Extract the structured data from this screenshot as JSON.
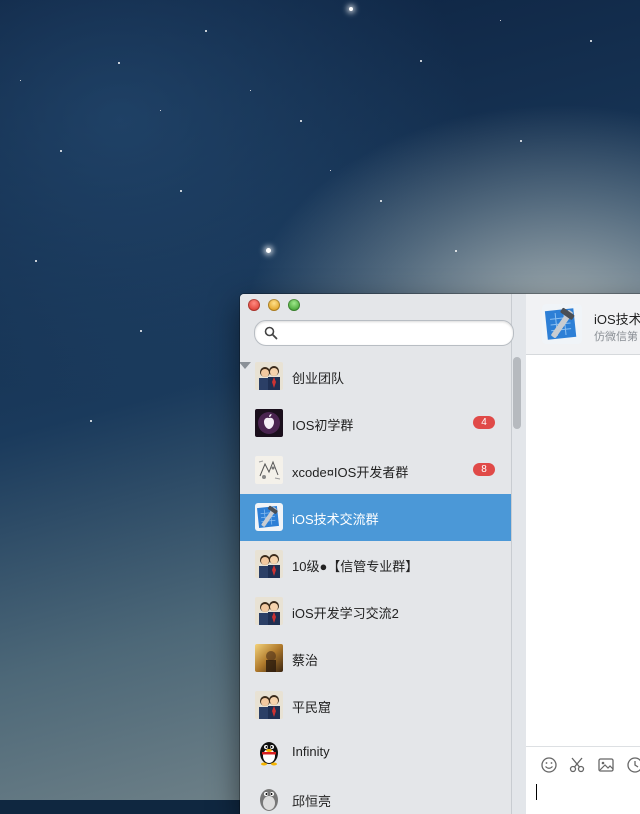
{
  "search": {
    "placeholder": ""
  },
  "conversations": [
    {
      "name": "创业团队",
      "badge": "",
      "avatar": "group-avatar",
      "selected": false
    },
    {
      "name": "IOS初学群",
      "badge": "4",
      "avatar": "apple-avatar",
      "selected": false
    },
    {
      "name": "xcode¤IOS开发者群",
      "badge": "8",
      "avatar": "sketch-avatar",
      "selected": false
    },
    {
      "name": "iOS技术交流群",
      "badge": "",
      "avatar": "xcode-avatar",
      "selected": true
    },
    {
      "name": "10级●【信管专业群】",
      "badge": "",
      "avatar": "group-avatar",
      "selected": false
    },
    {
      "name": "iOS开发学习交流2",
      "badge": "",
      "avatar": "group-avatar",
      "selected": false
    },
    {
      "name": "蔡治",
      "badge": "",
      "avatar": "photo-avatar",
      "selected": false
    },
    {
      "name": "平民窟",
      "badge": "",
      "avatar": "group-avatar",
      "selected": false
    },
    {
      "name": "Infinity",
      "badge": "",
      "avatar": "penguin-avatar",
      "selected": false
    },
    {
      "name": "邱恒亮",
      "badge": "",
      "avatar": "penguin-avatar",
      "selected": false
    }
  ],
  "chat": {
    "title": "iOS技术",
    "subtitle": "仿微信第",
    "toolbar_icons": [
      "emoji-icon",
      "scissors-icon",
      "image-icon",
      "history-icon"
    ]
  },
  "colors": {
    "selected_row": "#4b98d7",
    "badge": "#e04a48"
  }
}
